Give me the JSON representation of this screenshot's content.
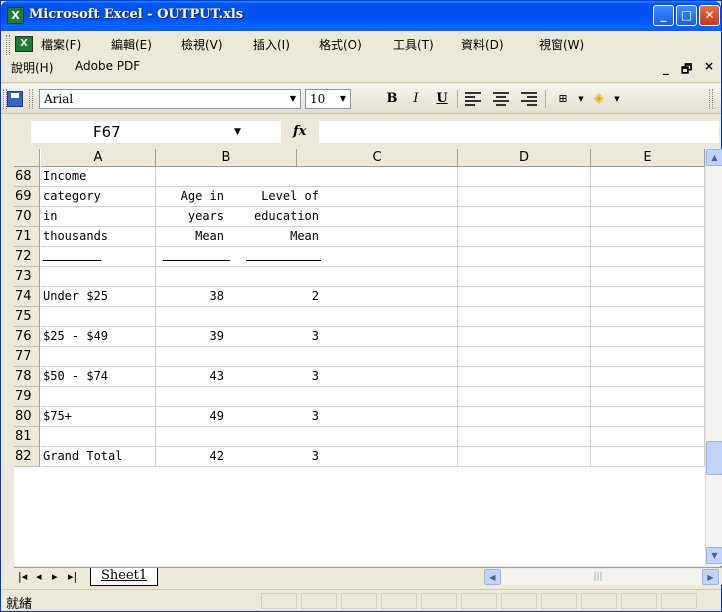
{
  "window": {
    "title": "Microsoft Excel - OUTPUT.xls",
    "minimize_label": "_",
    "maximize_label": "□",
    "close_label": "✕",
    "app_icon": "X"
  },
  "menu": {
    "items": [
      {
        "label": "檔案(F)"
      },
      {
        "label": "編輯(E)"
      },
      {
        "label": "檢視(V)"
      },
      {
        "label": "插入(I)"
      },
      {
        "label": "格式(O)"
      },
      {
        "label": "工具(T)"
      },
      {
        "label": "資料(D)"
      },
      {
        "label": "視窗(W)"
      },
      {
        "label": "說明(H)"
      },
      {
        "label": "Adobe PDF"
      }
    ],
    "doc_min": "_",
    "doc_restore": "🗗",
    "doc_close": "×"
  },
  "toolbar": {
    "font_name": "Arial",
    "font_size": "10",
    "bold": "B",
    "italic": "I",
    "underline": "U"
  },
  "formula_bar": {
    "name_box": "F67",
    "fx": "fx",
    "formula": ""
  },
  "grid": {
    "columns": [
      "A",
      "B",
      "C",
      "D",
      "E"
    ],
    "rows": [
      {
        "num": "68",
        "a": "Income",
        "b": "",
        "b2": ""
      },
      {
        "num": "69",
        "a": "category",
        "b": "Age in",
        "b2": "Level of"
      },
      {
        "num": "70",
        "a": "in",
        "b": "years",
        "b2": "education"
      },
      {
        "num": "71",
        "a": "thousands",
        "b": "Mean",
        "b2": "Mean"
      },
      {
        "num": "72",
        "a": "",
        "b": "",
        "b2": ""
      },
      {
        "num": "73",
        "a": "",
        "b": "",
        "b2": ""
      },
      {
        "num": "74",
        "a": "Under $25",
        "b": "38",
        "b2": "2"
      },
      {
        "num": "75",
        "a": "",
        "b": "",
        "b2": ""
      },
      {
        "num": "76",
        "a": "$25 - $49",
        "b": "39",
        "b2": "3"
      },
      {
        "num": "77",
        "a": "",
        "b": "",
        "b2": ""
      },
      {
        "num": "78",
        "a": "$50 - $74",
        "b": "43",
        "b2": "3"
      },
      {
        "num": "79",
        "a": "",
        "b": "",
        "b2": ""
      },
      {
        "num": "80",
        "a": "$75+",
        "b": "49",
        "b2": "3"
      },
      {
        "num": "81",
        "a": "",
        "b": "",
        "b2": ""
      },
      {
        "num": "82",
        "a": "Grand Total",
        "b": "42",
        "b2": "3"
      }
    ]
  },
  "tabs": {
    "sheet_name": "Sheet1",
    "nav": [
      "|◂",
      "◂",
      "▸",
      "▸|"
    ]
  },
  "status": {
    "text": "就緒"
  },
  "colors": {
    "title_bar": "#0053ee",
    "close_button": "#c6391b",
    "excel_green": "#1e7a34"
  }
}
